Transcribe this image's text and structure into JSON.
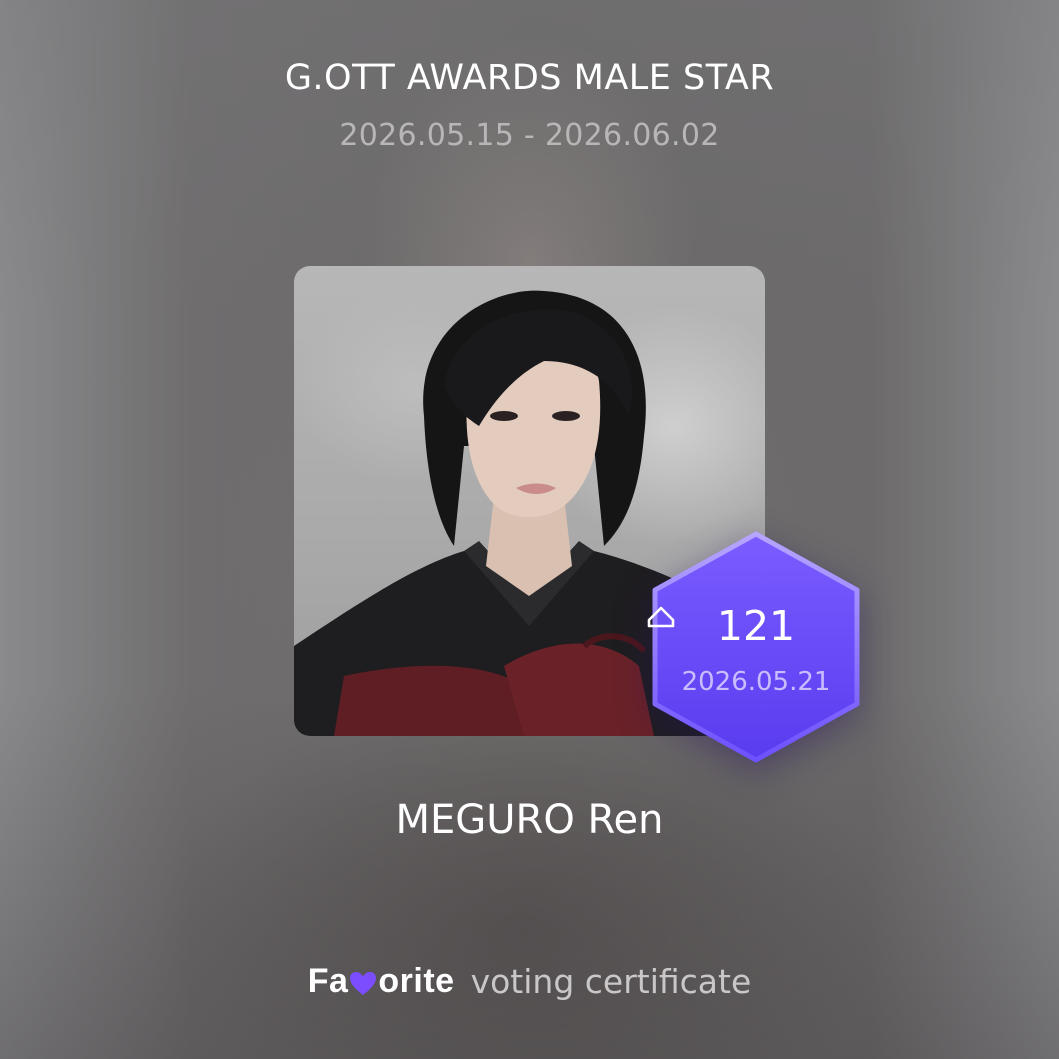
{
  "header": {
    "title": "G.OTT AWARDS MALE STAR",
    "dates": "2026.05.15 - 2026.06.02"
  },
  "candidate": {
    "photo": "portrait-photo",
    "name": "MEGURO Ren"
  },
  "badge": {
    "icon": "vote-ticket-icon",
    "count": "121",
    "date": "2026.05.21",
    "color": "#6a4cff"
  },
  "footer": {
    "logo_prefix": "Fa",
    "logo_suffix": "orite",
    "logo_heart_icon": "heart-icon",
    "logo_heart_color": "#7b4dff",
    "text": "voting certificate"
  }
}
